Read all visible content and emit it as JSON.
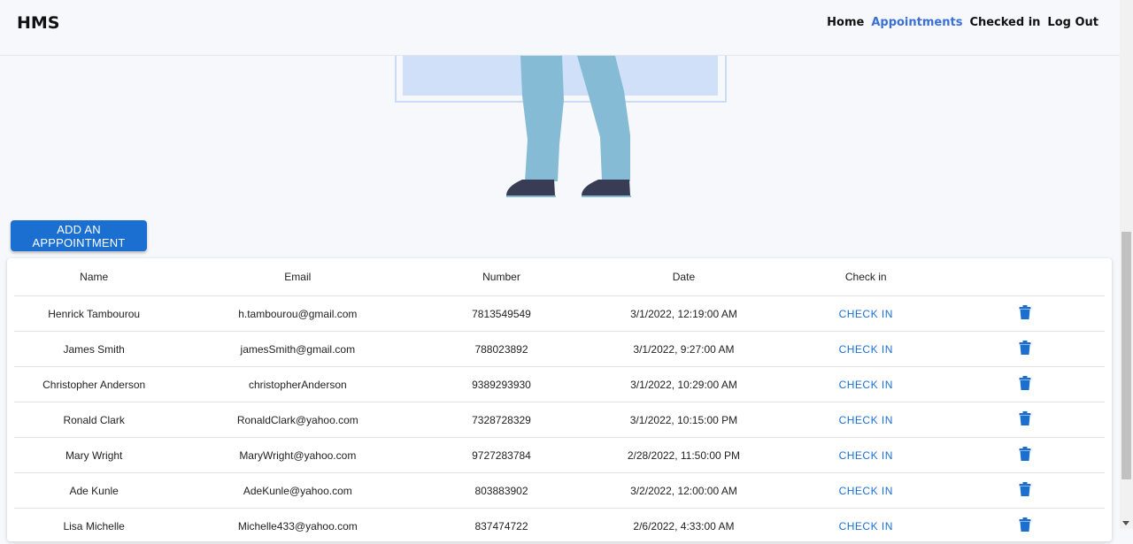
{
  "brand": "HMS",
  "nav": [
    {
      "label": "Home",
      "active": false
    },
    {
      "label": "Appointments",
      "active": true
    },
    {
      "label": "Checked in",
      "active": false
    },
    {
      "label": "Log Out",
      "active": false
    }
  ],
  "add_button_label": "ADD AN APPPOINTMENT",
  "table": {
    "headers": {
      "name": "Name",
      "email": "Email",
      "number": "Number",
      "date": "Date",
      "checkin": "Check in"
    },
    "checkin_label": "CHECK IN",
    "rows": [
      {
        "name": "Henrick Tambourou",
        "email": "h.tambourou@gmail.com",
        "number": "7813549549",
        "date": "3/1/2022, 12:19:00 AM"
      },
      {
        "name": "James Smith",
        "email": "jamesSmith@gmail.com",
        "number": "788023892",
        "date": "3/1/2022, 9:27:00 AM"
      },
      {
        "name": "Christopher Anderson",
        "email": "christopherAnderson",
        "number": "9389293930",
        "date": "3/1/2022, 10:29:00 AM"
      },
      {
        "name": "Ronald Clark",
        "email": "RonaldClark@yahoo.com",
        "number": "7328728329",
        "date": "3/1/2022, 10:15:00 PM"
      },
      {
        "name": "Mary Wright",
        "email": "MaryWright@yahoo.com",
        "number": "9727283784",
        "date": "2/28/2022, 11:50:00 PM"
      },
      {
        "name": "Ade Kunle",
        "email": "AdeKunle@yahoo.com",
        "number": "803883902",
        "date": "3/2/2022, 12:00:00 AM"
      },
      {
        "name": "Lisa Michelle",
        "email": "Michelle433@yahoo.com",
        "number": "837474722",
        "date": "2/6/2022, 4:33:00 AM"
      }
    ]
  },
  "colors": {
    "accent": "#1b6fd1",
    "nav_active": "#3b6fd8",
    "background": "#f6f8fc"
  },
  "icons": {
    "delete": "trash-icon"
  }
}
